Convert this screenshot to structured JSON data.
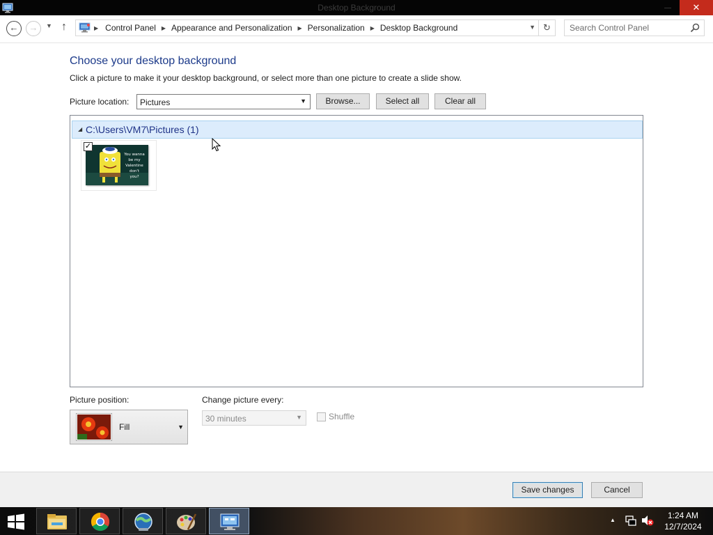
{
  "titlebar": {
    "title": "Desktop Background",
    "close_glyph": "✕",
    "icon": "control-panel-icon"
  },
  "nav": {
    "back_glyph": "←",
    "forward_glyph": "→",
    "recent_glyph": "▼",
    "up_glyph": "↑",
    "refresh_glyph": "↻",
    "breadcrumbs": [
      "Control Panel",
      "Appearance and Personalization",
      "Personalization",
      "Desktop Background"
    ],
    "search_placeholder": "Search Control Panel"
  },
  "main": {
    "heading": "Choose your desktop background",
    "subtext": "Click a picture to make it your desktop background, or select more than one picture to create a slide show.",
    "picture_location_label": "Picture location:",
    "picture_location_value": "Pictures",
    "browse_label": "Browse...",
    "select_all_label": "Select all",
    "clear_all_label": "Clear all",
    "group_title": "C:\\Users\\VM7\\Pictures (1)",
    "items": [
      {
        "checked": true,
        "thumb_text": "You wanna be my Valentine don't you?"
      }
    ],
    "picture_position_label": "Picture position:",
    "picture_position_value": "Fill",
    "change_every_label": "Change picture every:",
    "change_every_value": "30 minutes",
    "shuffle_label": "Shuffle",
    "shuffle_checked": false
  },
  "footer": {
    "save_label": "Save changes",
    "cancel_label": "Cancel"
  },
  "taskbar": {
    "apps": [
      "file-explorer-icon",
      "chrome-icon",
      "network-globe-icon",
      "paint-icon",
      "control-panel-icon"
    ],
    "active_app": "control-panel-icon",
    "time": "1:24 AM",
    "date": "12/7/2024"
  },
  "colors": {
    "heading": "#1c3a8a",
    "group_header_bg": "#dcecfc",
    "close_button": "#c42b1c"
  }
}
